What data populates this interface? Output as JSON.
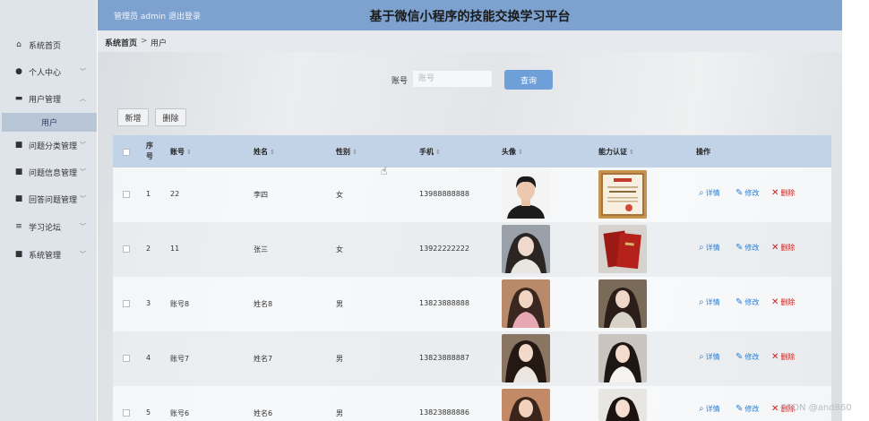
{
  "sidebar": {
    "items": [
      {
        "label": "系统首页",
        "icon": "home-icon",
        "glyph": "⌂"
      },
      {
        "label": "个人中心",
        "icon": "person-icon",
        "glyph": "●"
      },
      {
        "label": "用户管理",
        "icon": "comment-icon",
        "glyph": "▬"
      },
      {
        "label": "问题分类管理",
        "icon": "grid-icon",
        "glyph": "■"
      },
      {
        "label": "问题信息管理",
        "icon": "grid-icon",
        "glyph": "■"
      },
      {
        "label": "回答问题管理",
        "icon": "grid-icon",
        "glyph": "■"
      },
      {
        "label": "学习论坛",
        "icon": "sliders-icon",
        "glyph": "≡"
      },
      {
        "label": "系统管理",
        "icon": "grid-icon",
        "glyph": "■"
      }
    ],
    "sub_item": "用户"
  },
  "header": {
    "admin_label": "管理员 admin",
    "logout_label": "退出登录",
    "title": "基于微信小程序的技能交换学习平台"
  },
  "breadcrumb": {
    "home": "系统首页",
    "separator": ">",
    "current": "用户"
  },
  "search": {
    "label": "账号",
    "placeholder": "账号",
    "button": "查询"
  },
  "toolbar": {
    "add": "新增",
    "delete": "删除"
  },
  "table": {
    "headers": {
      "seq": "序号",
      "account": "账号",
      "name": "姓名",
      "gender": "性别",
      "phone": "手机",
      "avatar": "头像",
      "certification": "能力认证",
      "actions": "操作"
    },
    "rows": [
      {
        "seq": "1",
        "account": "22",
        "name": "李四",
        "gender": "女",
        "phone": "13988888888",
        "avatar": "male-portrait",
        "cert": "certificate-document"
      },
      {
        "seq": "2",
        "account": "11",
        "name": "张三",
        "gender": "女",
        "phone": "13922222222",
        "avatar": "female-portrait",
        "cert": "red-certificate-book"
      },
      {
        "seq": "3",
        "account": "账号8",
        "name": "姓名8",
        "gender": "男",
        "phone": "13823888888",
        "avatar": "female-portrait",
        "cert": "female-portrait"
      },
      {
        "seq": "4",
        "account": "账号7",
        "name": "姓名7",
        "gender": "男",
        "phone": "13823888887",
        "avatar": "female-portrait",
        "cert": "female-portrait"
      },
      {
        "seq": "5",
        "account": "账号6",
        "name": "姓名6",
        "gender": "男",
        "phone": "13823888886",
        "avatar": "female-portrait",
        "cert": "female-portrait"
      }
    ],
    "actions": {
      "detail": "详情",
      "edit": "修改",
      "delete": "删除"
    }
  },
  "watermark": "CSDN @and860",
  "colors": {
    "topbar": "#7da2cf",
    "sidebar": "#dfe3ea",
    "table_header": "#c3d3e7",
    "primary_button": "#6f9fd8",
    "delete_red": "#d0201b",
    "link_blue": "#2d7fd1"
  }
}
